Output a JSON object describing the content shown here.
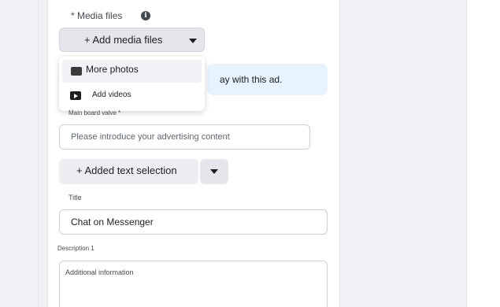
{
  "media": {
    "label": "* Media files",
    "info_icon": "i",
    "add_button_label": "+ Add media files"
  },
  "dropdown": {
    "items": [
      {
        "label": "More photos",
        "icon": "photo-icon"
      },
      {
        "label": "Add videos",
        "icon": "video-icon"
      }
    ]
  },
  "banner": {
    "text": "ay with this ad."
  },
  "main_board": {
    "label": "Main board valve *"
  },
  "ad_content": {
    "placeholder": "Please introduce your advertising content"
  },
  "text_selection": {
    "button_label": "+ Added text selection"
  },
  "title_field": {
    "label": "Title",
    "value": "Chat on Messenger"
  },
  "description": {
    "label": "Description 1",
    "placeholder": "Additional information"
  },
  "colors": {
    "page_bg": "#f0f2f5",
    "panel_bg": "#ffffff",
    "button_bg": "#e4e6eb",
    "banner_bg": "#e7f3ff",
    "text_primary": "#1c1e21"
  }
}
